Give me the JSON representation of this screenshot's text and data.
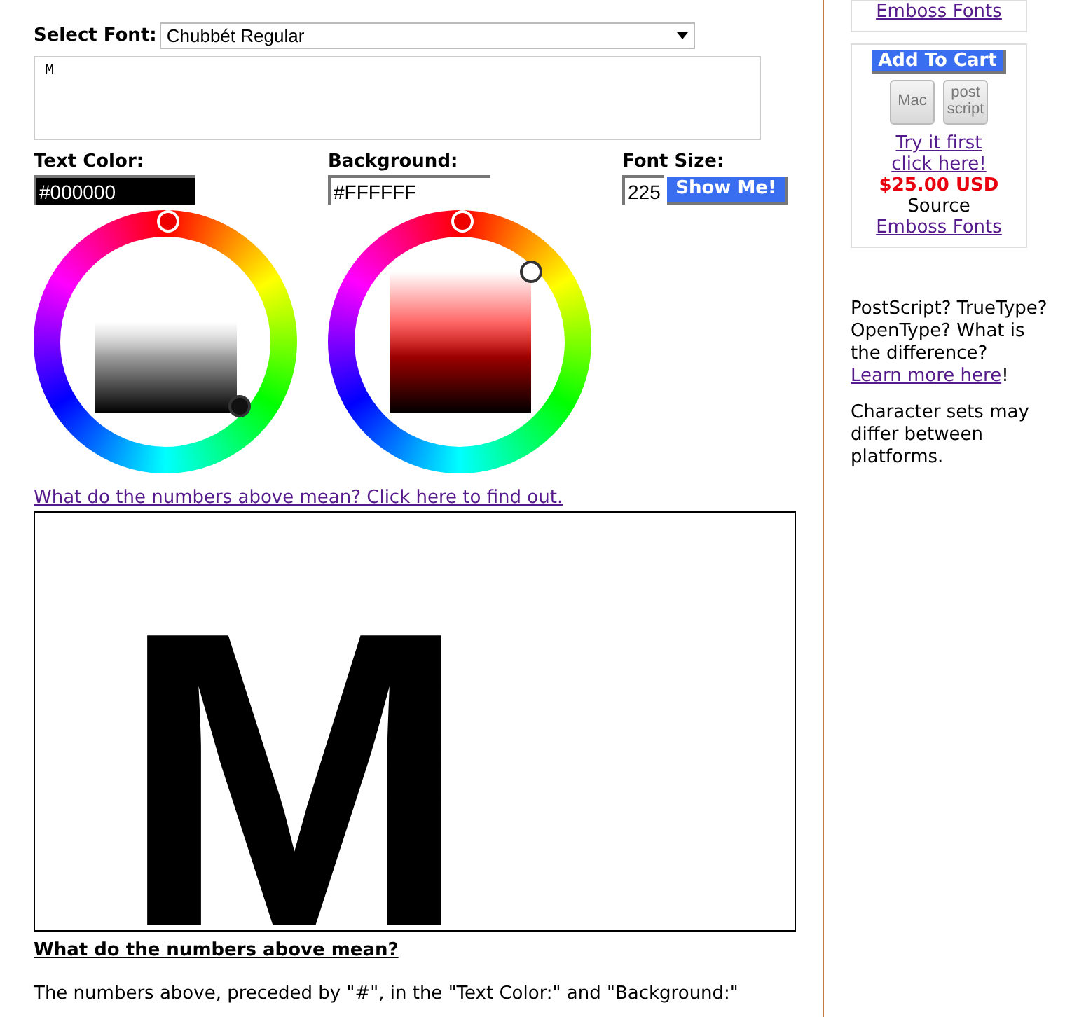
{
  "font_select": {
    "label": "Select Font:",
    "value": "Chubbét Regular"
  },
  "sample_text": {
    "value": "M"
  },
  "text_color": {
    "label": "Text Color:",
    "value": "#000000"
  },
  "background": {
    "label": "Background:",
    "value": "#FFFFFF"
  },
  "font_size": {
    "label": "Font Size:",
    "value": "225",
    "button": "Show Me!"
  },
  "help_link": "What do the numbers above mean? Click here to find out.",
  "preview": {
    "text": "M"
  },
  "explanation": {
    "heading": "What do the numbers above mean?",
    "paragraph": "The numbers above, preceded by \"#\", in the \"Text Color:\" and \"Background:\""
  },
  "sidebar": {
    "top_link": "Emboss Fonts",
    "cart": {
      "button": "Add To Cart",
      "formats": [
        "Mac",
        "post script"
      ],
      "try_link": [
        "Try it first",
        "click here!"
      ],
      "price": "$25.00 USD",
      "source_label": "Source",
      "source_link": "Emboss Fonts"
    },
    "notes": [
      {
        "text": "PostScript? TrueType? OpenType? What is the difference?",
        "link": "Learn more here",
        "tail": "!"
      },
      {
        "text": "Character sets may differ between platforms."
      }
    ]
  }
}
